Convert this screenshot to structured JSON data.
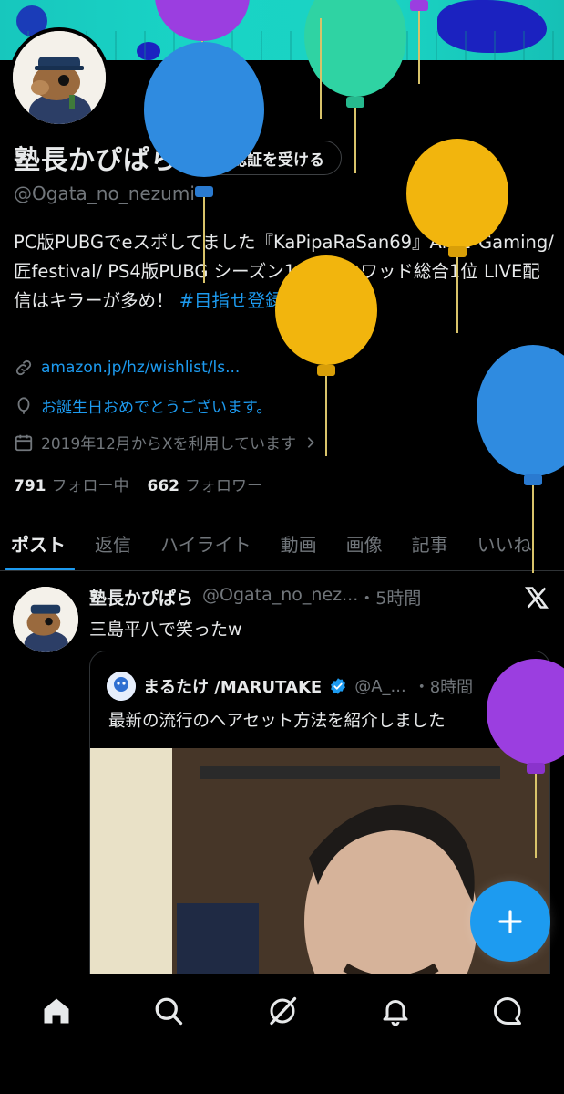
{
  "profile": {
    "display_name": "塾長かぴぱら",
    "verify_label": "認証を受ける",
    "handle": "@Ogata_no_nezumi",
    "bio_text": "PC版PUBGでeスポしてました『KaPipaRaSan69』Ant1-Gaming/匠festival/ PS4版PUBG シーズン1:ASスクワッド総合1位 LIVE配信はキラーが多め！ ",
    "bio_hashtag": "#目指せ登録者1000人",
    "link": "amazon.jp/hz/wishlist/ls...",
    "birthday": "お誕生日おめでとうございます。",
    "joined": "2019年12月からXを利用しています",
    "following_count": "791",
    "following_label": "フォロー中",
    "followers_count": "662",
    "followers_label": "フォロワー"
  },
  "tabs": [
    {
      "label": "ポスト",
      "active": true
    },
    {
      "label": "返信"
    },
    {
      "label": "ハイライト"
    },
    {
      "label": "動画"
    },
    {
      "label": "画像"
    },
    {
      "label": "記事"
    },
    {
      "label": "いいね"
    }
  ],
  "post": {
    "author_name": "塾長かぴぱら",
    "author_handle": "@Ogata_no_nez...",
    "time": "・5時間",
    "text": "三島平八で笑ったw",
    "quote": {
      "author_name": "まるたけ /MARUTAKE",
      "author_handle": "@A_...",
      "time": "・8時間",
      "text": "最新の流行のヘアセット方法を紹介しました"
    }
  },
  "nav": {
    "items": [
      "home-icon",
      "search-icon",
      "grok-icon",
      "notifications-icon",
      "messages-icon"
    ]
  },
  "colors": {
    "accent": "#1d9bf0",
    "background": "#000000",
    "muted": "#71767b",
    "text": "#e7e9ea"
  }
}
